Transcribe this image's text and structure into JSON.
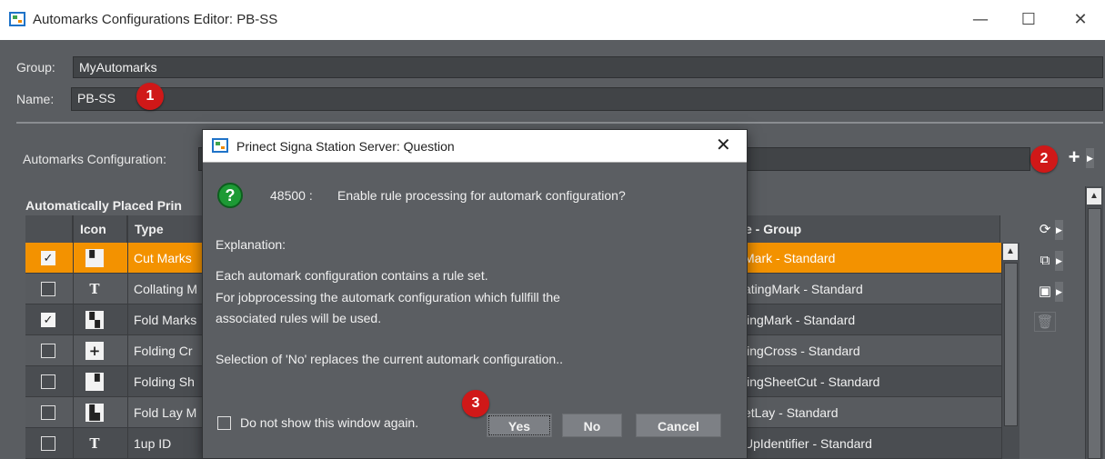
{
  "window": {
    "title": "Automarks Configurations Editor: PB-SS",
    "minimize_glyph": "—",
    "maximize_glyph": "☐",
    "close_glyph": "✕"
  },
  "form": {
    "group_label": "Group:",
    "group_value": "MyAutomarks",
    "name_label": "Name:",
    "name_value": "PB-SS",
    "config_label": "Automarks Configuration:"
  },
  "badges": [
    "1",
    "2",
    "3"
  ],
  "section": {
    "title": "Automatically Placed Prin"
  },
  "table": {
    "headers": {
      "icon": "Icon",
      "type": "Type",
      "name_group": "e - Group"
    },
    "rows": [
      {
        "checked": true,
        "icon_glyph": "▘",
        "type": "Cut Marks",
        "name_group": "Mark - Standard",
        "selected": true
      },
      {
        "checked": false,
        "icon_glyph": "T",
        "type": "Collating M",
        "name_group": "atingMark - Standard"
      },
      {
        "checked": true,
        "icon_glyph": "▚",
        "type": "Fold Marks",
        "name_group": "lingMark - Standard"
      },
      {
        "checked": false,
        "icon_glyph": "+",
        "type": "Folding Cr",
        "name_group": "lingCross - Standard"
      },
      {
        "checked": false,
        "icon_glyph": "▝",
        "type": "Folding Sh",
        "name_group": "lingSheetCut - Standard"
      },
      {
        "checked": false,
        "icon_glyph": "▙",
        "type": "Fold Lay M",
        "name_group": "etLay - Standard"
      },
      {
        "checked": false,
        "icon_glyph": "T",
        "type": "1up ID",
        "name_group": "UpIdentifier - Standard"
      }
    ]
  },
  "dialog": {
    "title": "Prinect Signa Station Server: Question",
    "close_glyph": "✕",
    "question_code": "48500 :",
    "question": "Enable rule processing for automark configuration?",
    "explanation_label": "Explanation:",
    "line1": "Each automark configuration contains a rule set.",
    "line2": "For jobprocessing the automark configuration which fullfill the",
    "line3": "associated rules will be used.",
    "line4": "Selection of 'No' replaces the current automark configuration..",
    "dont_show": "Do not show this window again.",
    "yes": "Yes",
    "no": "No",
    "cancel": "Cancel"
  },
  "colors": {
    "selected_row": "#f39200",
    "badge": "#d01818",
    "question_icon": "#1d9a35"
  },
  "icons": [
    "app-icon",
    "question-icon",
    "add-icon",
    "refresh-icon",
    "import-icon",
    "export-icon",
    "delete-icon"
  ]
}
